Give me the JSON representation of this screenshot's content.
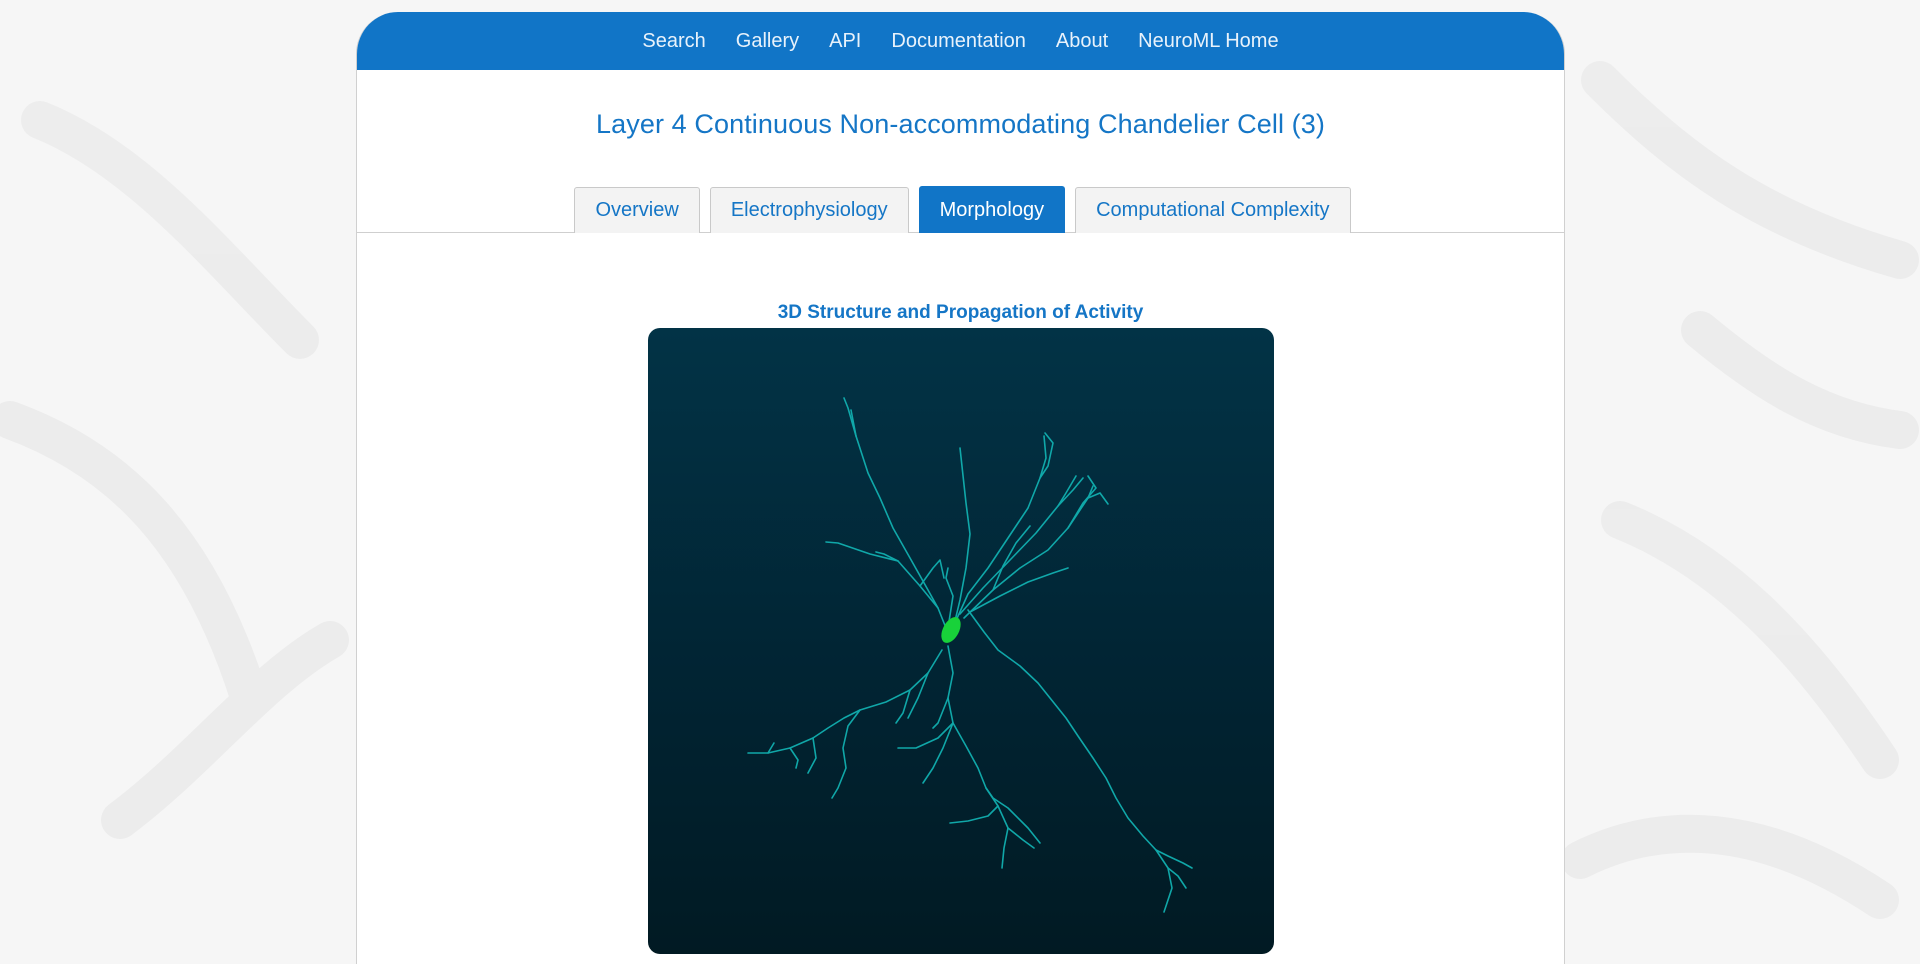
{
  "nav": {
    "items": [
      {
        "label": "Search"
      },
      {
        "label": "Gallery"
      },
      {
        "label": "API"
      },
      {
        "label": "Documentation"
      },
      {
        "label": "About"
      },
      {
        "label": "NeuroML Home"
      }
    ]
  },
  "page": {
    "title": "Layer 4 Continuous Non-accommodating Chandelier Cell (3)"
  },
  "tabs": {
    "items": [
      {
        "label": "Overview",
        "active": false
      },
      {
        "label": "Electrophysiology",
        "active": false
      },
      {
        "label": "Morphology",
        "active": true
      },
      {
        "label": "Computational Complexity",
        "active": false
      }
    ]
  },
  "morphology": {
    "section_title": "3D Structure and Propagation of Activity"
  },
  "colors": {
    "accent": "#1175c7",
    "link": "#1576c6",
    "dendrite": "#12b3b3",
    "soma": "#18d23a",
    "viewer_top": "#023346",
    "viewer_bottom": "#011a23"
  }
}
